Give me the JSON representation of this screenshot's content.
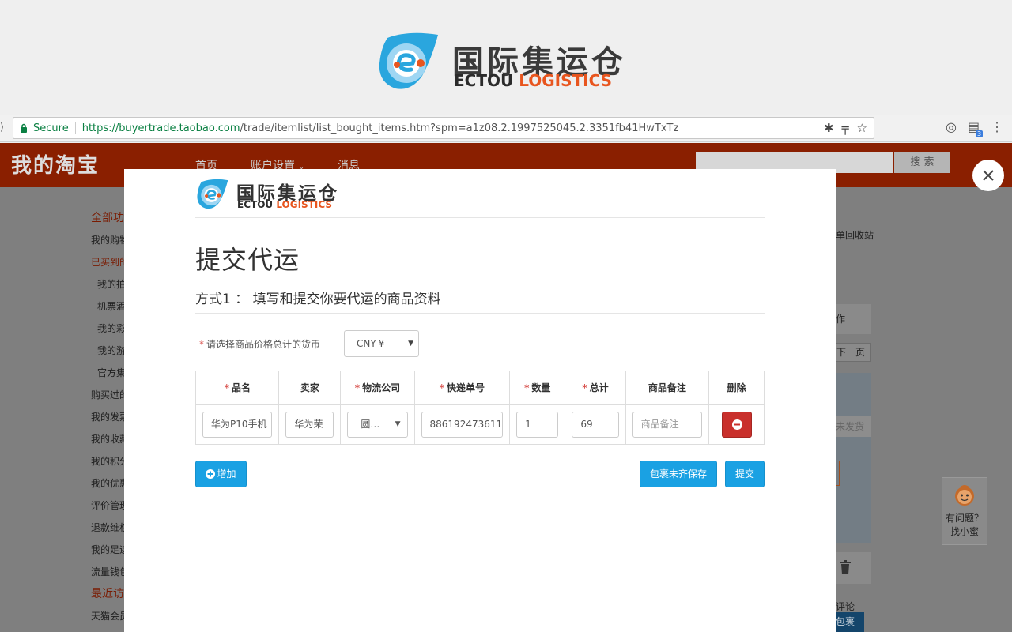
{
  "banner": {
    "brand_cn": "国际集运仓",
    "brand_en_a": "ECTOU ",
    "brand_en_b": "LOGISTICS"
  },
  "browser": {
    "secure_label": "Secure",
    "url_host": "https://buyertrade.taobao.com",
    "url_path": "/trade/itemlist/list_bought_items.htm?spm=a1z08.2.1997525045.2.3351fb41HwTxTz",
    "extension_badge": "3"
  },
  "taobao": {
    "logo": "我的淘宝",
    "nav": [
      "首页",
      "账户设置",
      "消息"
    ],
    "search_button": "搜 索",
    "sidebar": [
      {
        "label": "全部功",
        "type": "hd"
      },
      {
        "label": "我的购物",
        "type": "item"
      },
      {
        "label": "已买到的",
        "type": "act"
      },
      {
        "label": "我的拍",
        "type": "sub"
      },
      {
        "label": "机票酒",
        "type": "sub"
      },
      {
        "label": "我的彩",
        "type": "sub"
      },
      {
        "label": "我的游",
        "type": "sub"
      },
      {
        "label": "官方集",
        "type": "sub"
      },
      {
        "label": "购买过的",
        "type": "item"
      },
      {
        "label": "我的发票",
        "type": "item"
      },
      {
        "label": "我的收藏",
        "type": "item"
      },
      {
        "label": "我的积分",
        "type": "item"
      },
      {
        "label": "我的优惠",
        "type": "item"
      },
      {
        "label": "评价管理",
        "type": "item"
      },
      {
        "label": "退款维权",
        "type": "item"
      },
      {
        "label": "我的足迹",
        "type": "item"
      },
      {
        "label": "流量钱包",
        "type": "item"
      },
      {
        "label": "最近访",
        "type": "hd"
      },
      {
        "label": "天猫会员",
        "type": "item"
      }
    ],
    "right_recycle": "单回收站",
    "right_operate": "作",
    "right_next": "下一页",
    "right_remind": "未发货",
    "right_comment": "评论",
    "right_package": "包裹",
    "helper_line1": "有问题？",
    "helper_line2": "找小蜜"
  },
  "modal": {
    "logo_cn": "国际集运仓",
    "logo_en_a": "ECTOU ",
    "logo_en_b": "LOGISTICS",
    "title": "提交代运",
    "subtitle": "方式1 ： 填写和提交你要代运的商品资料",
    "currency_label": "请选择商品价格总计的货币",
    "currency_value": "CNY-¥",
    "required_mark": "*",
    "columns": [
      {
        "label": "品名",
        "required": true
      },
      {
        "label": "卖家",
        "required": false
      },
      {
        "label": "物流公司",
        "required": true
      },
      {
        "label": "快递单号",
        "required": true
      },
      {
        "label": "数量",
        "required": true
      },
      {
        "label": "总计",
        "required": true
      },
      {
        "label": "商品备注",
        "required": false
      },
      {
        "label": "删除",
        "required": false
      }
    ],
    "row": {
      "product_name": "华为P10手机",
      "seller": "华为荣",
      "logistics": "圆…",
      "tracking_no": "886192473611",
      "quantity": "1",
      "total": "69",
      "remark_placeholder": "商品备注"
    },
    "add_label": "增加",
    "save_label": "包裹未齐保存",
    "submit_label": "提交"
  },
  "colors": {
    "accent_blue": "#1aa1e3",
    "danger_red": "#c9302c",
    "brand_orange": "#e8551e",
    "taobao_header": "#8a1f00"
  }
}
